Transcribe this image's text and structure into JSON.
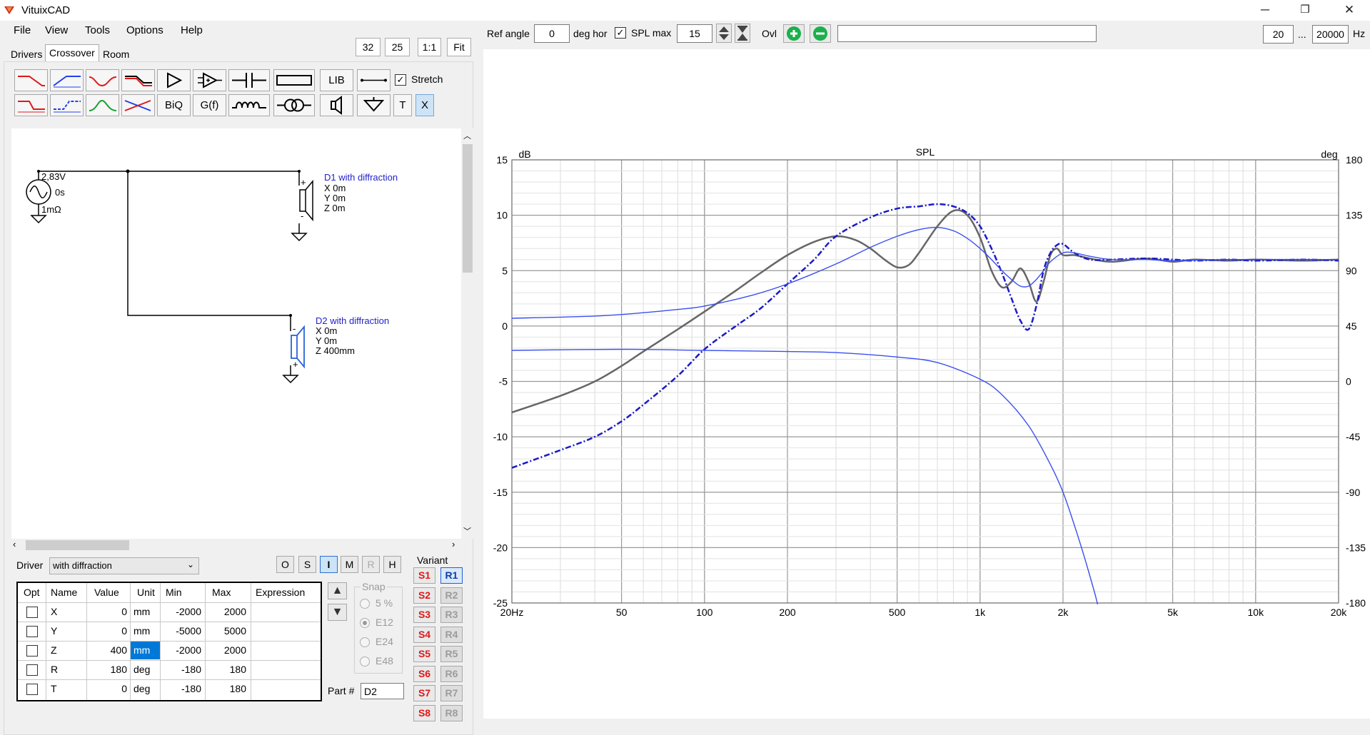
{
  "window": {
    "title": "VituixCAD",
    "minimize": "─",
    "maximize": "❐",
    "close": "✕"
  },
  "menu": [
    "File",
    "View",
    "Tools",
    "Options",
    "Help"
  ],
  "tabs": [
    "Drivers",
    "Crossover",
    "Room"
  ],
  "zoom": {
    "a": "32",
    "b": "25",
    "one": "1:1",
    "fit": "Fit"
  },
  "toolbar": {
    "lib": "LIB",
    "biq": "BiQ",
    "gf": "G(f)",
    "t": "T",
    "x": "X",
    "stretch_label": "Stretch",
    "stretch_checked": true
  },
  "schematic": {
    "source": {
      "voltage": "2,83V",
      "delay": "0s",
      "impedance": "1mΩ"
    },
    "d1": {
      "name": "D1 with diffraction",
      "x": "X 0m",
      "y": "Y 0m",
      "z": "Z 0m",
      "plus": "+",
      "minus": "-"
    },
    "d2": {
      "name": "D2 with diffraction",
      "x": "X 0m",
      "y": "Y 0m",
      "z": "Z 400mm",
      "plus": "+",
      "minus": "-"
    }
  },
  "driver": {
    "label": "Driver",
    "value": "with diffraction"
  },
  "mode_buttons": [
    "O",
    "S",
    "I",
    "M",
    "R",
    "H"
  ],
  "table": {
    "headers": [
      "Opt",
      "Name",
      "Value",
      "Unit",
      "Min",
      "Max",
      "Expression"
    ],
    "rows": [
      {
        "name": "X",
        "value": "0",
        "unit": "mm",
        "min": "-2000",
        "max": "2000",
        "expr": ""
      },
      {
        "name": "Y",
        "value": "0",
        "unit": "mm",
        "min": "-5000",
        "max": "5000",
        "expr": ""
      },
      {
        "name": "Z",
        "value": "400",
        "unit": "mm",
        "min": "-2000",
        "max": "2000",
        "expr": ""
      },
      {
        "name": "R",
        "value": "180",
        "unit": "deg",
        "min": "-180",
        "max": "180",
        "expr": ""
      },
      {
        "name": "T",
        "value": "0",
        "unit": "deg",
        "min": "-180",
        "max": "180",
        "expr": ""
      }
    ]
  },
  "arrows": {
    "up": "▲",
    "down": "▼"
  },
  "snap": {
    "label": "Snap",
    "options": [
      "5 %",
      "E12",
      "E24",
      "E48"
    ],
    "selected": "E12"
  },
  "part": {
    "label": "Part #",
    "value": "D2"
  },
  "variant": {
    "label": "Variant",
    "s": [
      "S1",
      "S2",
      "S3",
      "S4",
      "S5",
      "S6",
      "S7",
      "S8"
    ],
    "r": [
      "R1",
      "R2",
      "R3",
      "R4",
      "R5",
      "R6",
      "R7",
      "R8"
    ],
    "selected": "R1"
  },
  "top_controls": {
    "ref_angle_label": "Ref angle",
    "ref_angle": "0",
    "deg_hor": "deg hor",
    "spl_max_label": "SPL max",
    "spl_max": "15",
    "spl_max_checked": true,
    "ovl": "Ovl",
    "ovl_text": "",
    "freq_min": "20",
    "ellipsis": "...",
    "freq_max": "20000",
    "hz": "Hz"
  },
  "colors": {
    "accent_red": "#e01818",
    "accent_blue": "#2e3df0",
    "grey_curve": "#606060",
    "dark_blue": "#1a1ac8",
    "plus_green": "#1cb04c"
  },
  "chart_data": {
    "type": "line",
    "title": "SPL",
    "ylabel": "dB",
    "y2label": "deg",
    "xscale": "log",
    "xlim": [
      20,
      20000
    ],
    "ylim": [
      -25,
      15
    ],
    "y2lim": [
      -180,
      180
    ],
    "yticks": [
      15,
      10,
      5,
      0,
      -5,
      -10,
      -15,
      -20,
      -25
    ],
    "y2ticks": [
      180,
      135,
      90,
      45,
      0,
      -45,
      -90,
      -135,
      -180
    ],
    "xticks": [
      {
        "v": 20,
        "l": "20Hz"
      },
      {
        "v": 50,
        "l": "50"
      },
      {
        "v": 100,
        "l": "100"
      },
      {
        "v": 200,
        "l": "200"
      },
      {
        "v": 500,
        "l": "500"
      },
      {
        "v": 1000,
        "l": "1k"
      },
      {
        "v": 2000,
        "l": "2k"
      },
      {
        "v": 5000,
        "l": "5k"
      },
      {
        "v": 10000,
        "l": "10k"
      },
      {
        "v": 20000,
        "l": "20k"
      }
    ],
    "grid": true,
    "series": [
      {
        "color": "#666666",
        "width": 2.5,
        "dash": "",
        "x": [
          20,
          30,
          40,
          50,
          60,
          80,
          100,
          130,
          160,
          200,
          250,
          300,
          350,
          400,
          450,
          500,
          550,
          600,
          700,
          800,
          900,
          1000,
          1100,
          1200,
          1300,
          1400,
          1500,
          1600,
          1700,
          1800,
          1900,
          2000,
          2200,
          2500,
          3000,
          4000,
          5000,
          6000,
          8000,
          10000,
          15000,
          20000
        ],
        "y": [
          -7.8,
          -6.3,
          -5.0,
          -3.6,
          -2.3,
          -0.3,
          1.3,
          3.2,
          4.8,
          6.4,
          7.6,
          8.1,
          7.8,
          7.0,
          6.0,
          5.3,
          5.5,
          6.6,
          9.0,
          10.4,
          10.0,
          8.0,
          5.0,
          3.5,
          4.0,
          5.2,
          4.0,
          2.2,
          4.0,
          6.4,
          7.0,
          6.4,
          6.4,
          6.1,
          5.8,
          6.1,
          5.8,
          6.0,
          5.9,
          6.0,
          5.9,
          6.0
        ]
      },
      {
        "color": "#1a1ac8",
        "width": 2.5,
        "dash": "8,3,2,3",
        "x": [
          20,
          30,
          40,
          50,
          60,
          80,
          100,
          130,
          160,
          200,
          250,
          300,
          400,
          500,
          600,
          700,
          800,
          900,
          1000,
          1100,
          1200,
          1300,
          1400,
          1500,
          1600,
          1700,
          1800,
          1900,
          2000,
          2200,
          2500,
          3000,
          4000,
          5000,
          6000,
          8000,
          10000,
          15000,
          20000
        ],
        "y": [
          -12.8,
          -11.2,
          -10.0,
          -8.6,
          -7.1,
          -4.5,
          -2.1,
          0.0,
          1.6,
          3.8,
          6.0,
          8.1,
          9.8,
          10.6,
          10.8,
          11.0,
          10.8,
          10.2,
          9.0,
          7.0,
          4.8,
          2.5,
          0.5,
          -0.3,
          1.8,
          5.0,
          6.6,
          7.3,
          7.4,
          6.6,
          6.0,
          6.0,
          6.1,
          6.0,
          5.9,
          6.0,
          5.9,
          6.0,
          5.9
        ]
      },
      {
        "color": "#3a4ff0",
        "width": 1.4,
        "dash": "",
        "x": [
          20,
          40,
          60,
          80,
          100,
          150,
          200,
          300,
          400,
          500,
          600,
          700,
          800,
          900,
          1000,
          1100,
          1200,
          1300,
          1400,
          1500,
          1600,
          1700,
          1800,
          2000,
          2200,
          2500,
          3000,
          4000,
          5000,
          8000,
          20000
        ],
        "y": [
          0.7,
          0.9,
          1.2,
          1.5,
          1.8,
          2.8,
          3.8,
          5.6,
          7.1,
          8.1,
          8.7,
          8.9,
          8.6,
          7.9,
          7.0,
          6.0,
          5.0,
          4.2,
          3.6,
          3.6,
          4.2,
          5.0,
          5.8,
          6.6,
          6.6,
          6.3,
          6.0,
          6.0,
          5.9,
          6.0,
          6.0
        ]
      },
      {
        "color": "#3a4ff0",
        "width": 1.4,
        "dash": "",
        "x": [
          20,
          50,
          100,
          200,
          300,
          500,
          700,
          1000,
          1200,
          1500,
          1800,
          2000,
          2200,
          2400,
          2600,
          2700,
          2800
        ],
        "y": [
          -2.2,
          -2.1,
          -2.2,
          -2.3,
          -2.4,
          -2.8,
          -3.3,
          -4.8,
          -6.2,
          -9.0,
          -12.5,
          -15.0,
          -18.0,
          -21.0,
          -24.0,
          -25.5,
          -26.0
        ]
      }
    ]
  }
}
